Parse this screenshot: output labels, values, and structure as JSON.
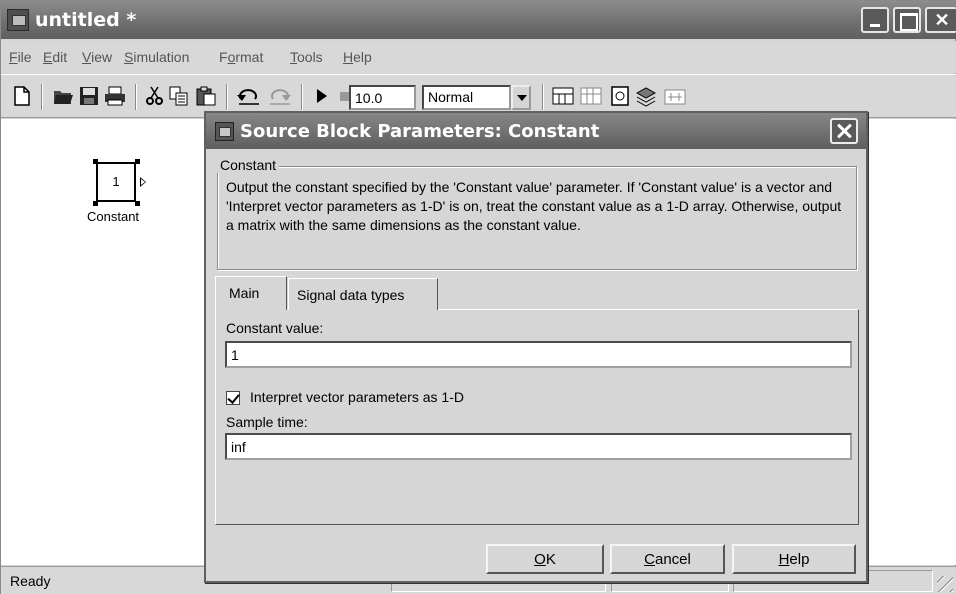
{
  "window": {
    "title": "untitled *"
  },
  "menu": [
    {
      "mnemonic": "F",
      "rest": "ile"
    },
    {
      "mnemonic": "E",
      "rest": "dit"
    },
    {
      "mnemonic": "V",
      "rest": "iew"
    },
    {
      "mnemonic": "S",
      "rest": "imulation"
    },
    {
      "pre": "F",
      "mnemonic": "o",
      "rest": "rmat"
    },
    {
      "mnemonic": "T",
      "rest": "ools"
    },
    {
      "mnemonic": "H",
      "rest": "elp"
    }
  ],
  "toolbar": {
    "stop_time": "10.0",
    "sim_mode": "Normal",
    "icons": [
      "new-model-icon",
      "open-icon",
      "save-icon",
      "print-icon",
      "cut-icon",
      "copy-icon",
      "paste-icon",
      "undo-icon",
      "redo-icon",
      "run-icon",
      "stop-icon",
      "build-icon",
      "update-diagram-icon",
      "library-browser-icon",
      "model-explorer-icon",
      "debugger-icon"
    ]
  },
  "canvas": {
    "block": {
      "value": "1",
      "label": "Constant"
    }
  },
  "status": {
    "text": "Ready"
  },
  "dialog": {
    "title": "Source Block Parameters: Constant",
    "group_title": "Constant",
    "description": "Output the constant specified by the 'Constant value' parameter. If 'Constant value' is a vector and 'Interpret vector parameters as 1-D' is on, treat the constant value as a 1-D array. Otherwise, output a matrix with the same dimensions as the constant value.",
    "tabs": [
      {
        "label": "Main",
        "active": true
      },
      {
        "label": "Signal data types",
        "active": false
      }
    ],
    "constant_label": "Constant value:",
    "constant_value": "1",
    "interpret_label": "Interpret vector parameters as 1-D",
    "interpret_checked": true,
    "sample_label": "Sample time:",
    "sample_value": "inf",
    "buttons": {
      "ok": {
        "mnemonic": "O",
        "rest": "K"
      },
      "cancel": {
        "mnemonic": "C",
        "rest": "ancel"
      },
      "help": {
        "mnemonic": "H",
        "rest": "elp"
      }
    }
  }
}
